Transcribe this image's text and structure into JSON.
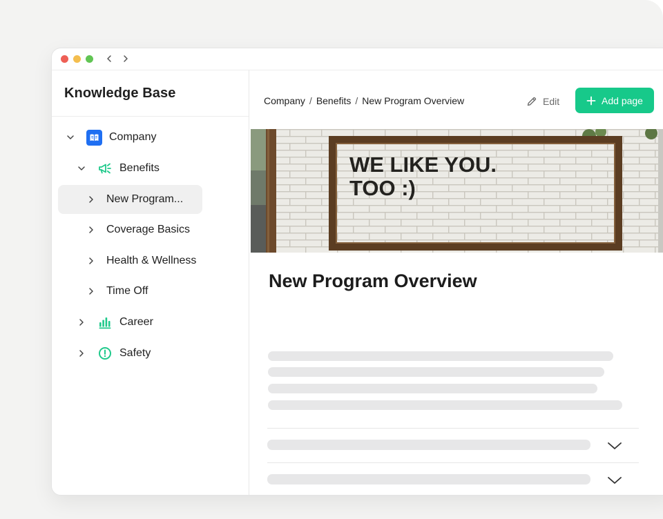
{
  "sidebar": {
    "title": "Knowledge Base",
    "tree": {
      "company": "Company",
      "benefits": "Benefits",
      "new_program": "New Program...",
      "coverage_basics": "Coverage Basics",
      "health_wellness": "Health & Wellness",
      "time_off": "Time Off",
      "career": "Career",
      "safety": "Safety"
    }
  },
  "header": {
    "breadcrumb": [
      "Company",
      "Benefits",
      "New Program Overview"
    ],
    "breadcrumb_separator": "/",
    "edit_label": "Edit",
    "add_page_label": "Add page"
  },
  "hero": {
    "sign_line1": "WE LIKE YOU.",
    "sign_line2": "TOO :)"
  },
  "page": {
    "title": "New Program Overview"
  },
  "colors": {
    "accent_green": "#17c98a",
    "company_icon_blue": "#1f6ff2",
    "icon_green": "#1fc98b"
  },
  "icons": {
    "company": "book-icon",
    "benefits": "megaphone-icon",
    "career": "bar-chart-icon",
    "safety": "alert-circle-icon",
    "edit": "pencil-icon",
    "add": "plus-icon"
  }
}
